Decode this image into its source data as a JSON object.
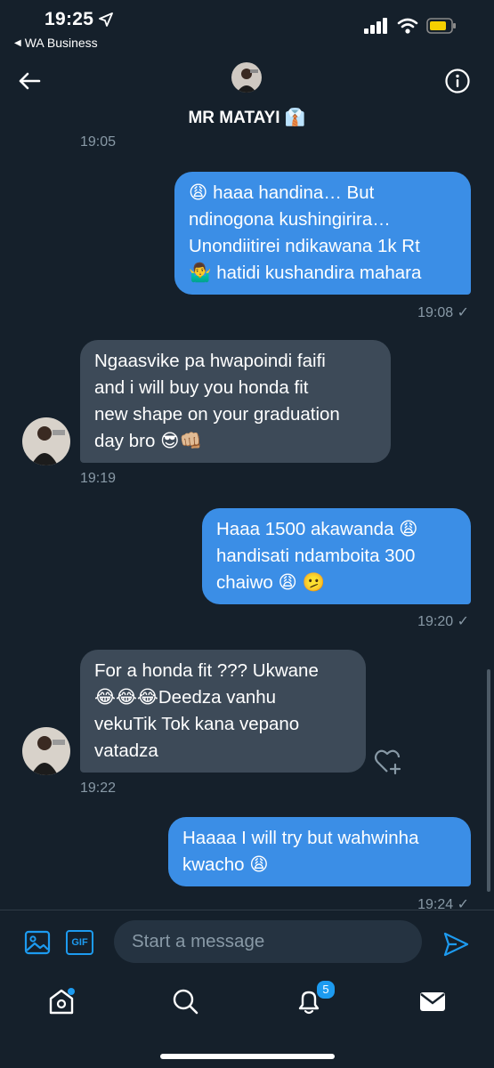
{
  "status_bar": {
    "time": "19:25",
    "back_app": "WA Business"
  },
  "header": {
    "contact_name": "MR MATAYI 👔"
  },
  "messages": [
    {
      "direction": "timestamp",
      "time": "19:05"
    },
    {
      "direction": "sent",
      "text": "😩 haaa handina… But\nndinogona kushingirira…\nUnondiitirei ndikawana 1k Rt\n🤷‍♂️ hatidi kushandira mahara",
      "time": "19:08 ✓"
    },
    {
      "direction": "received",
      "text": "Ngaasvike pa hwapoindi faifi\nand i will buy you honda fit\nnew shape on your graduation\nday bro 😎👊🏼",
      "time": "19:19"
    },
    {
      "direction": "sent",
      "text": "Haaa 1500 akawanda 😩\nhandisati ndamboita 300\nchaiwo 😩 🫤",
      "time": "19:20 ✓"
    },
    {
      "direction": "received",
      "text": "For a honda fit ??? Ukwane\n😂😂😂Deedza vanhu\nvekuTik Tok kana vepano\nvatadza",
      "time": "19:22"
    },
    {
      "direction": "sent",
      "text": "Haaaa I will try but wahwinha\nkwacho 😩",
      "time": "19:24 ✓"
    }
  ],
  "composer": {
    "placeholder": "Start a message",
    "gif_label": "GIF"
  },
  "tabbar": {
    "notifications_count": "5"
  },
  "colors": {
    "background": "#15202b",
    "sent_bubble": "#3b8ee6",
    "received_bubble": "#3d4a58",
    "accent": "#1d9bf0"
  }
}
